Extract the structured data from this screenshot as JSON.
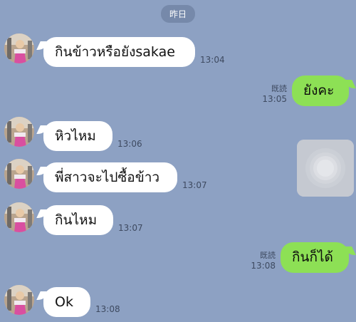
{
  "date_separator": "昨日",
  "messages": [
    {
      "type": "incoming",
      "text": "กินข้าวหรือยังsakae",
      "time": "13:04"
    },
    {
      "type": "outgoing",
      "text": "ยังคะ",
      "read": "既読",
      "time": "13:05"
    },
    {
      "type": "incoming",
      "text": "หิวไหม",
      "time": "13:06"
    },
    {
      "type": "outgoing-image",
      "description_icon": "loading-image-icon"
    },
    {
      "type": "incoming",
      "text": "พี่สาวจะไปซื้อข้าว",
      "time": "13:07"
    },
    {
      "type": "incoming",
      "text": "กินไหม",
      "time": "13:07"
    },
    {
      "type": "outgoing",
      "text": "กินก็ได้",
      "read": "既読",
      "time": "13:08"
    },
    {
      "type": "incoming",
      "text": "Ok",
      "time": "13:08"
    }
  ],
  "colors": {
    "background": "#8da1c3",
    "incoming_bubble": "#ffffff",
    "outgoing_bubble": "#8de055",
    "timestamp_text": "#3e4a60"
  }
}
